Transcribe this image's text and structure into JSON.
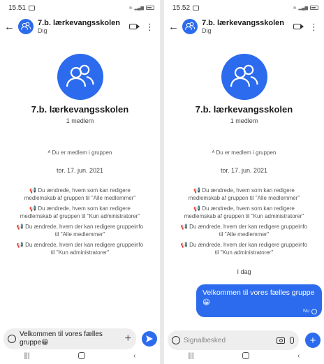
{
  "colors": {
    "accent": "#2c6bed",
    "bubble_text": "#ffffff",
    "background": "#ffffff"
  },
  "left_screen": {
    "status": {
      "time": "15.51"
    },
    "header": {
      "title": "7.b. lærkevangsskolen",
      "subtitle": "Dig"
    },
    "group": {
      "name": "7.b. lærkevangsskolen",
      "members": "1 medlem"
    },
    "events": {
      "member_icon": "ᴬ",
      "you_are_member": "Du er medlem i gruppen",
      "date": "tor. 17. jun. 2021",
      "change1_line1": "Du ændrede, hvem som kan redigere",
      "change1_line2": "medlemskab af gruppen til \"Alle medlemmer\"",
      "change2_line1": "Du ændrede, hvem som kan redigere",
      "change2_line2": "medlemskab af gruppen til \"Kun administratorer\"",
      "change3_line1": "Du ændrede, hvem der kan redigere gruppeinfo",
      "change3_line2": "til \"Alle medlemmer\"",
      "change4_line1": "Du ændrede, hvem der kan redigere gruppeinfo",
      "change4_line2": "til \"Kun administratorer\""
    },
    "composer": {
      "text_line1": "Velkommen til vores fælles",
      "text_line2": "gruppe😀"
    },
    "icons": [
      "back-arrow-icon",
      "group-avatar-icon",
      "video-call-icon",
      "more-options-icon",
      "megaphone-icon",
      "emoji-icon",
      "plus-icon",
      "send-icon"
    ]
  },
  "right_screen": {
    "status": {
      "time": "15.52"
    },
    "header": {
      "title": "7.b. lærkevangsskolen",
      "subtitle": "Dig"
    },
    "group": {
      "name": "7.b. lærkevangsskolen",
      "members": "1 medlem"
    },
    "events": {
      "you_are_member": "Du er medlem i gruppen",
      "date": "tor. 17. jun. 2021",
      "change1_line1": "Du ændrede, hvem som kan redigere",
      "change1_line2": "medlemskab af gruppen til \"Alle medlemmer\"",
      "change2_line1": "Du ændrede, hvem som kan redigere",
      "change2_line2": "medlemskab af gruppen til \"Kun administratorer\"",
      "change3_line1": "Du ændrede, hvem der kan redigere gruppeinfo",
      "change3_line2": "til \"Alle medlemmer\"",
      "change4_line1": "Du ændrede, hvem der kan redigere gruppeinfo",
      "change4_line2": "til \"Kun administratorer\""
    },
    "today_label": "I dag",
    "message": {
      "text_line1": "Velkommen til vores fælles gruppe",
      "text_line2": "😀",
      "time": "Nu"
    },
    "composer": {
      "placeholder": "Signalbesked"
    },
    "icons": [
      "back-arrow-icon",
      "group-avatar-icon",
      "video-call-icon",
      "more-options-icon",
      "megaphone-icon",
      "emoji-icon",
      "camera-icon",
      "microphone-icon",
      "plus-icon"
    ]
  }
}
